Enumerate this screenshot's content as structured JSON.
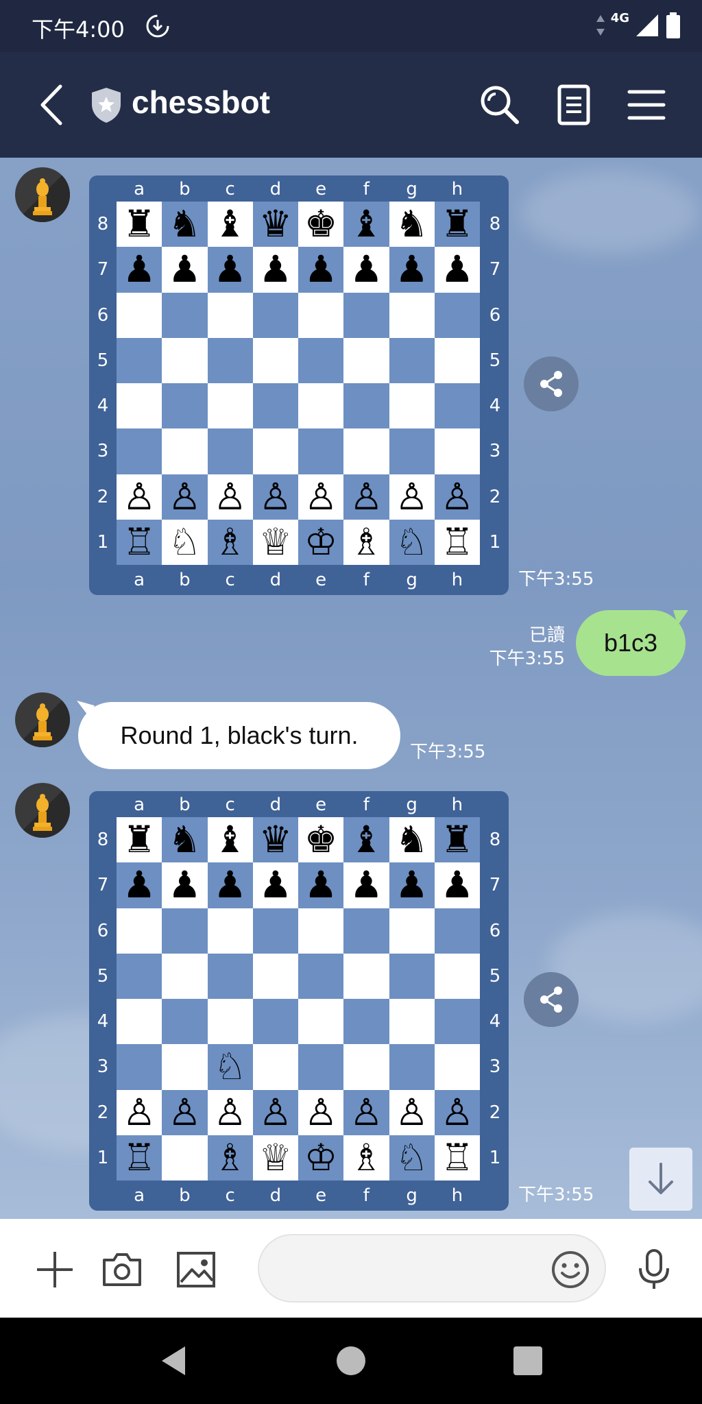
{
  "status_bar": {
    "time": "下午4:00",
    "network": "4G"
  },
  "header": {
    "title": "chessbot"
  },
  "files": [
    "a",
    "b",
    "c",
    "d",
    "e",
    "f",
    "g",
    "h"
  ],
  "ranks": [
    "8",
    "7",
    "6",
    "5",
    "4",
    "3",
    "2",
    "1"
  ],
  "messages": {
    "board1": {
      "position": [
        "rnbqkbnr",
        "pppppppp",
        "........",
        "........",
        "........",
        "........",
        "PPPPPPPP",
        "RNBQKBNR"
      ],
      "timestamp": "下午3:55"
    },
    "user_move": {
      "text": "b1c3",
      "read_label": "已讀",
      "timestamp": "下午3:55"
    },
    "bot_text": {
      "text": "Round 1, black's turn.",
      "timestamp": "下午3:55"
    },
    "board2": {
      "position": [
        "rnbqkbnr",
        "pppppppp",
        "........",
        "........",
        "........",
        "..N.....",
        "PPPPPPPP",
        "R.BQKBNR"
      ],
      "timestamp": "下午3:55"
    }
  },
  "input": {
    "placeholder": ""
  },
  "colors": {
    "header": "#232d47",
    "board_frame": "#3f6297",
    "dark_square": "#6d8fc2",
    "user_bubble": "#a7e28f"
  }
}
